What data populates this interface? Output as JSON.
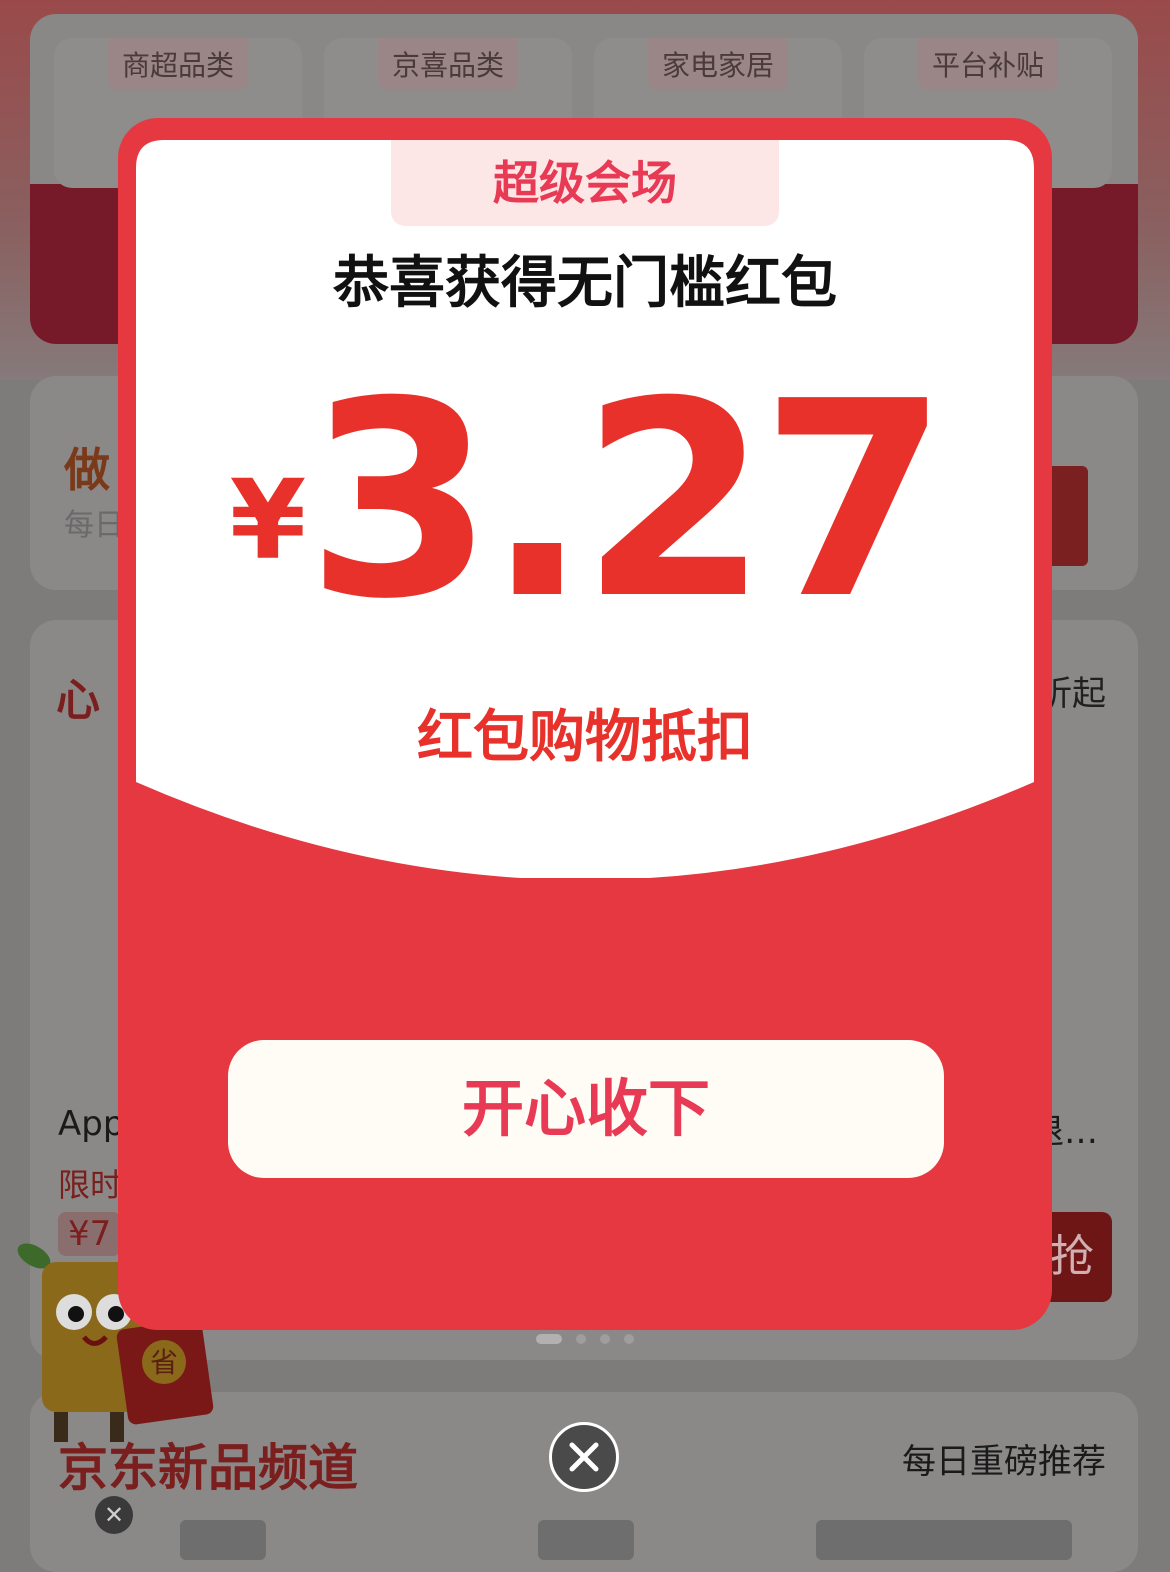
{
  "background": {
    "categories": [
      "商超品类",
      "京喜品类",
      "家电家居",
      "平台补贴"
    ],
    "card2": {
      "title_partial": "做",
      "subtitle_partial": "每日"
    },
    "card3": {
      "title_partial": "心",
      "right_partial": "折起",
      "product_name_partial": "App",
      "product_right_partial": "退…",
      "limit_partial": "限时",
      "price_partial": "¥7",
      "grab_partial": "抢"
    },
    "card4": {
      "title": "京东新品频道",
      "right": "每日重磅推荐"
    },
    "mascot_badge": "省"
  },
  "popup": {
    "tag": "超级会场",
    "headline": "恭喜获得无门槛红包",
    "currency": "¥",
    "amount": "3.27",
    "subline": "红包购物抵扣",
    "accept_label": "开心收下"
  },
  "colors": {
    "popup_red": "#e53840",
    "amount_red": "#e8312a",
    "tag_bg": "#fde6e6"
  }
}
